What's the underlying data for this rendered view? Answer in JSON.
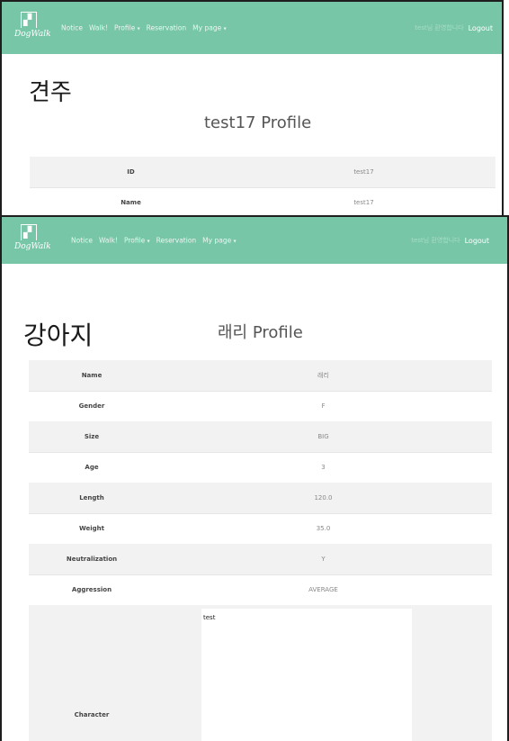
{
  "nav": {
    "logo_text": "DogWalk",
    "logo_icon": "dog-in-box-icon",
    "items": [
      {
        "label": "Notice",
        "dropdown": false
      },
      {
        "label": "Walk!",
        "dropdown": false
      },
      {
        "label": "Profile",
        "dropdown": true
      },
      {
        "label": "Reservation",
        "dropdown": false
      },
      {
        "label": "My page",
        "dropdown": true
      }
    ],
    "caret": "▾",
    "welcome": "test님 환영합니다",
    "logout": "Logout",
    "color": "#78c6a8"
  },
  "owner": {
    "heading": "견주",
    "title": "test17 Profile",
    "rows": [
      {
        "label": "ID",
        "value": "test17"
      },
      {
        "label": "Name",
        "value": "test17"
      }
    ]
  },
  "dog": {
    "heading": "강아지",
    "title": "래리 Profile",
    "rows": [
      {
        "label": "Name",
        "value": "래리"
      },
      {
        "label": "Gender",
        "value": "F"
      },
      {
        "label": "Size",
        "value": "BIG"
      },
      {
        "label": "Age",
        "value": "3"
      },
      {
        "label": "Length",
        "value": "120.0"
      },
      {
        "label": "Weight",
        "value": "35.0"
      },
      {
        "label": "Neutralization",
        "value": "Y"
      },
      {
        "label": "Aggression",
        "value": "AVERAGE"
      }
    ],
    "character": {
      "label": "Character",
      "value": "test"
    }
  }
}
